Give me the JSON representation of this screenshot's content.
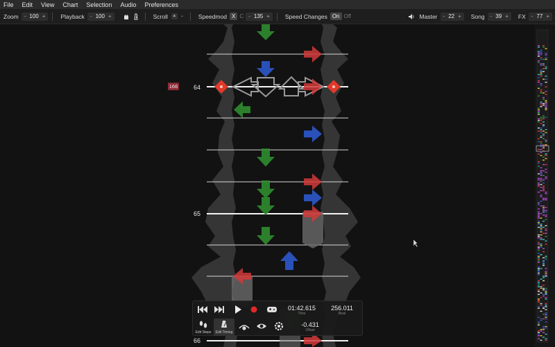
{
  "menubar": {
    "items": [
      "File",
      "Edit",
      "View",
      "Chart",
      "Selection",
      "Audio",
      "Preferences"
    ]
  },
  "toolbar": {
    "zoom_label": "Zoom",
    "zoom_value": "100",
    "playback_label": "Playback",
    "playback_value": "100",
    "scroll_label": "Scroll",
    "speedmod_label": "Speedmod",
    "speedmod_x": "X",
    "speedmod_c": "C",
    "speedmod_value": "135",
    "speed_changes_label": "Speed Changes",
    "speed_on": "On",
    "speed_off": "Off",
    "master_label": "Master",
    "master_value": "22",
    "song_label": "Song",
    "song_value": "39",
    "fx_label": "FX",
    "fx_value": "77",
    "minus": "-",
    "plus": "+"
  },
  "editor": {
    "measure_flag": "166",
    "measures": [
      "64",
      "65",
      "66"
    ]
  },
  "transport": {
    "time": "01:42.615",
    "time_label": "Time",
    "beat": "256.011",
    "beat_label": "Beat",
    "offset": "-0.431",
    "offset_label": "Offset",
    "edit_steps": "Edit Steps",
    "edit_timing": "Edit Timing"
  },
  "colors": {
    "red": "#d13a3a",
    "blue": "#2c57c9",
    "green": "#2f8a2f",
    "gray": "#8a8a8a",
    "mine": "#e23a2a"
  }
}
